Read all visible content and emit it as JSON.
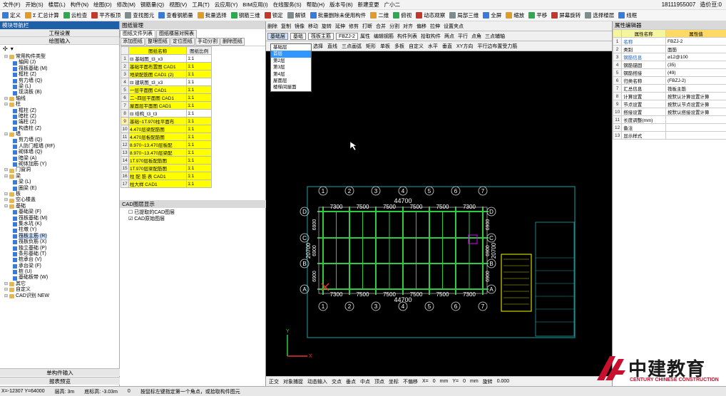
{
  "menu": [
    "文件(F)",
    "开始(S)",
    "楼层(L)",
    "构件(N)",
    "绘图(D)",
    "修改(M)",
    "钢筋量(Q)",
    "视图(V)",
    "工具(T)",
    "云应用(Y)",
    "BIM应用(I)",
    "在线服务(S)",
    "帮助(H)",
    "版本号(B)",
    "新建变更",
    "广小二"
  ],
  "menu_right": {
    "phone": "18111955007",
    "extra": "造价豆:0"
  },
  "toolbar1": [
    "定义",
    "Σ 汇总计算",
    "云检查",
    "平齐板顶",
    "查找图元",
    "查看钢筋量",
    "批量选择",
    "钢筋三维",
    "锁定",
    "解锁",
    "批量删除未使用构件",
    "二维",
    "俯视",
    "动态观察",
    "局部三维",
    "全屏",
    "缩放",
    "平移",
    "屏幕旋转",
    "选择楼层",
    "线框"
  ],
  "left": {
    "title": "模块导航栏",
    "tab1": "工程设置",
    "tab2": "绘图输入",
    "tree": [
      {
        "t": "常用构件类型",
        "lvl": 0,
        "f": 1
      },
      {
        "t": "轴网 (J)",
        "lvl": 1
      },
      {
        "t": "筏板基础 (M)",
        "lvl": 1
      },
      {
        "t": "框柱 (Z)",
        "lvl": 1
      },
      {
        "t": "剪力墙 (Q)",
        "lvl": 1
      },
      {
        "t": "梁 (L)",
        "lvl": 1
      },
      {
        "t": "现浇板 (B)",
        "lvl": 1
      },
      {
        "t": "轴线",
        "lvl": 0,
        "f": 1
      },
      {
        "t": "柱",
        "lvl": 0,
        "f": 1
      },
      {
        "t": "框柱 (Z)",
        "lvl": 1
      },
      {
        "t": "暗柱 (Z)",
        "lvl": 1
      },
      {
        "t": "端柱 (Z)",
        "lvl": 1
      },
      {
        "t": "构造柱 (Z)",
        "lvl": 1
      },
      {
        "t": "墙",
        "lvl": 0,
        "f": 1
      },
      {
        "t": "剪力墙 (Q)",
        "lvl": 1
      },
      {
        "t": "人防门框墙 (RF)",
        "lvl": 1
      },
      {
        "t": "砌体墙 (Q)",
        "lvl": 1
      },
      {
        "t": "暗梁 (A)",
        "lvl": 1
      },
      {
        "t": "砌体加筋 (Y)",
        "lvl": 1
      },
      {
        "t": "门窗洞",
        "lvl": 0,
        "f": 1
      },
      {
        "t": "梁",
        "lvl": 0,
        "f": 1
      },
      {
        "t": "梁 (L)",
        "lvl": 1
      },
      {
        "t": "圈梁 (E)",
        "lvl": 1
      },
      {
        "t": "板",
        "lvl": 0,
        "f": 1
      },
      {
        "t": "空心楼盖",
        "lvl": 0,
        "f": 1
      },
      {
        "t": "基础",
        "lvl": 0,
        "f": 1
      },
      {
        "t": "基础梁 (F)",
        "lvl": 1
      },
      {
        "t": "筏板基础 (M)",
        "lvl": 1
      },
      {
        "t": "集水坑 (K)",
        "lvl": 1
      },
      {
        "t": "柱墩 (Y)",
        "lvl": 1
      },
      {
        "t": "筏板主筋 (R)",
        "lvl": 1,
        "sel": 1
      },
      {
        "t": "筏板负筋 (X)",
        "lvl": 1
      },
      {
        "t": "独立基础 (P)",
        "lvl": 1
      },
      {
        "t": "条形基础 (T)",
        "lvl": 1
      },
      {
        "t": "桩承台 (V)",
        "lvl": 1
      },
      {
        "t": "承台梁 (F)",
        "lvl": 1
      },
      {
        "t": "桩 (U)",
        "lvl": 1
      },
      {
        "t": "基础板带 (W)",
        "lvl": 1
      },
      {
        "t": "其它",
        "lvl": 0,
        "f": 1
      },
      {
        "t": "自定义",
        "lvl": 0,
        "f": 1
      },
      {
        "t": "CAD识别 NEW",
        "lvl": 0,
        "f": 1
      }
    ],
    "bottom1": "单构件输入",
    "bottom2": "报表预览"
  },
  "mid": {
    "title": "图纸管理",
    "tab_a": "图纸文件列表",
    "tab_b": "图纸楼层对照表",
    "buttons": [
      "添加图纸",
      "整理图纸",
      "定位图纸",
      "手动分割",
      "删除图纸"
    ],
    "col_name": "图纸名称",
    "col_ratio": "图纸比例",
    "rows": [
      {
        "n": "1",
        "name": "基础图_t3_x3",
        "ratio": "1:1",
        "grp": 1
      },
      {
        "n": "2",
        "name": "基础平面布置图 CAD1",
        "ratio": "1:1"
      },
      {
        "n": "3",
        "name": "地梁配筋图 CAD1 (2)",
        "ratio": "1:1"
      },
      {
        "n": "4",
        "name": "建筑图_t3_x3",
        "ratio": "1:1",
        "grp": 1
      },
      {
        "n": "5",
        "name": "一层平面图 CAD1",
        "ratio": "1:1"
      },
      {
        "n": "6",
        "name": "二~四层平面图 CAD1",
        "ratio": "1:1"
      },
      {
        "n": "7",
        "name": "屋面层平面图 CAD1",
        "ratio": "1:1"
      },
      {
        "n": "8",
        "name": "结构_t3_t3",
        "ratio": "1:1",
        "grp": 1
      },
      {
        "n": "9",
        "name": "基础~1T.970柱平面布",
        "ratio": "1:1",
        "sel": 1
      },
      {
        "n": "10",
        "name": "4.470层梁配筋图",
        "ratio": "1:1"
      },
      {
        "n": "11",
        "name": "4.470层板配筋图",
        "ratio": "1:1"
      },
      {
        "n": "12",
        "name": "8.970~13.470层板配",
        "ratio": "1:1"
      },
      {
        "n": "13",
        "name": "8.970~13.470层梁配",
        "ratio": "1:1"
      },
      {
        "n": "14",
        "name": "1T.970层板配筋图",
        "ratio": "1:1"
      },
      {
        "n": "15",
        "name": "1T.970层梁配筋图",
        "ratio": "1:1"
      },
      {
        "n": "16",
        "name": "柱 配 筋 表 CAD1",
        "ratio": "1:1"
      },
      {
        "n": "17",
        "name": "柱大样 CAD1",
        "ratio": "1:1"
      }
    ],
    "cad_title": "CAD图层显示",
    "cad_items": [
      "已提取的CAD图层",
      "CAD原始图层"
    ]
  },
  "canvas": {
    "floor_label": "基础层",
    "floor_options": [
      "基础层",
      "首层",
      "第2层",
      "第3层",
      "第4层",
      "屋面层",
      "楼梯间屋面"
    ],
    "floor_selected_index": 1,
    "tool1": [
      "删除",
      "复制",
      "镜像",
      "移动",
      "旋转",
      "延伸",
      "修剪",
      "打断",
      "合并",
      "分割",
      "对齐",
      "偏移",
      "拉伸",
      "设置夹点"
    ],
    "type_select": "基础",
    "sub_select": "筏板主筋",
    "code_select": "FBZJ-2",
    "tool2": [
      "属性",
      "编辑钢筋",
      "构件列表",
      "拾取构件",
      "两点",
      "平行",
      "点角",
      "三点辅轴"
    ],
    "tool3": [
      "选择",
      "直线",
      "三点画弧",
      "矩形",
      "单板",
      "多板",
      "自定义",
      "水平",
      "垂直",
      "XY方向",
      "平行边布置受力筋"
    ],
    "axes_top": [
      "1",
      "2",
      "3",
      "4",
      "5",
      "6",
      "7"
    ],
    "axes_left": [
      "D",
      "C",
      "B",
      "A"
    ],
    "dim_total": "44700",
    "dim_spans": [
      "7300",
      "7500",
      "7500",
      "7500",
      "7500",
      "7300"
    ],
    "dim_left": [
      "6900",
      "6900",
      "6900"
    ],
    "dim_left_total": "20700",
    "bottom": [
      "正交",
      "对象捕捉",
      "动态输入",
      "交点",
      "垂点",
      "中点",
      "顶点",
      "坐标",
      "不偏移",
      "X=",
      "0",
      "mm",
      "Y=",
      "0",
      "mm",
      "旋转",
      "0.000"
    ]
  },
  "right": {
    "title": "属性编辑器",
    "col_name": "属性名称",
    "col_value": "属性值",
    "rows": [
      {
        "n": "1",
        "k": "名称",
        "v": "FBZJ-2",
        "blue": 1
      },
      {
        "n": "2",
        "k": "类别",
        "v": "面筋"
      },
      {
        "n": "3",
        "k": "钢筋信息",
        "v": "⌀12@100",
        "blue": 1
      },
      {
        "n": "4",
        "k": "钢筋锚固",
        "v": "(35)"
      },
      {
        "n": "5",
        "k": "钢筋搭接",
        "v": "(49)"
      },
      {
        "n": "6",
        "k": "归类名称",
        "v": "(FBZJ-2)"
      },
      {
        "n": "7",
        "k": "汇总信息",
        "v": "筏板主筋"
      },
      {
        "n": "8",
        "k": "计算设置",
        "v": "按默认计算设置计算"
      },
      {
        "n": "9",
        "k": "节点设置",
        "v": "按默认节点设置计算"
      },
      {
        "n": "10",
        "k": "搭接设置",
        "v": "按默认搭接设置计算"
      },
      {
        "n": "11",
        "k": "长度调整(mm)",
        "v": ""
      },
      {
        "n": "12",
        "k": "备注",
        "v": ""
      },
      {
        "n": "13",
        "k": "显示样式",
        "v": ""
      }
    ]
  },
  "status": [
    "X=-12307  Y=64000",
    "层高: 3m",
    "底标高: -3.03m",
    "0",
    "按鼠标左键指定第一个角点，或拾取构件图元"
  ],
  "logo": {
    "cn": "中建教育",
    "en": "CENTURY CHINESE CONSTRUCTION",
    "color": "#c8102e"
  }
}
